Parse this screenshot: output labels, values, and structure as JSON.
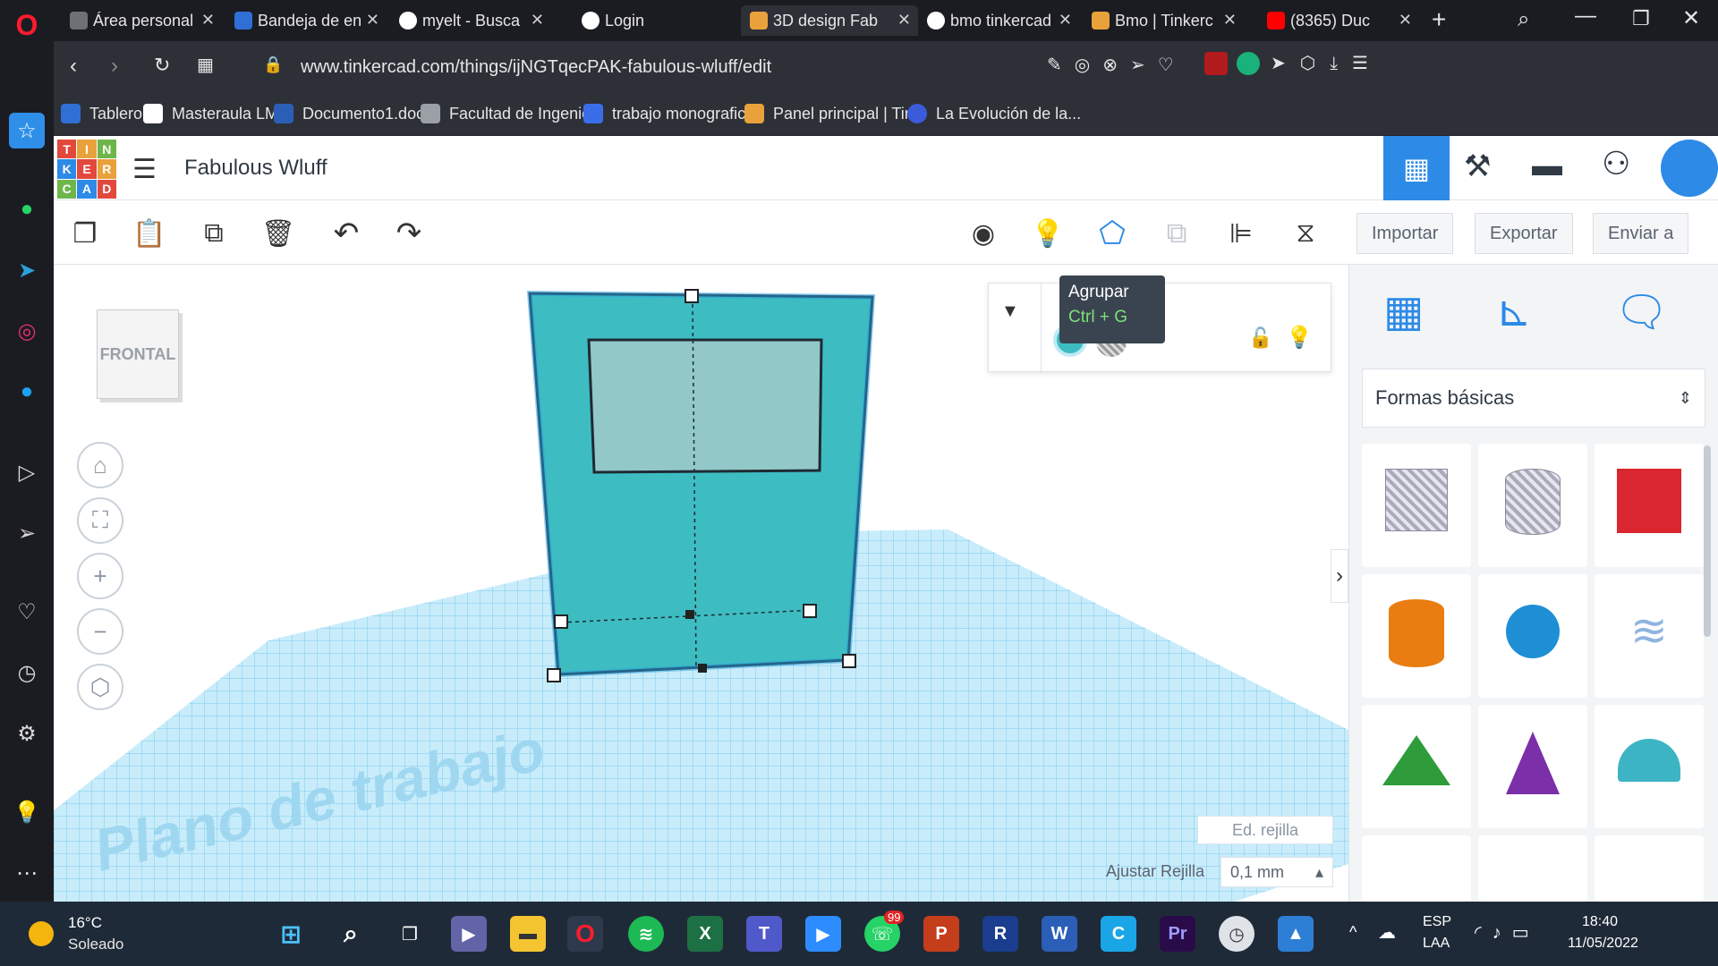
{
  "browser": {
    "tabs": [
      {
        "label": "Área personal",
        "icon": "moodle-icon",
        "color": "#6d7177"
      },
      {
        "label": "Bandeja de en",
        "icon": "mail-icon",
        "color": "#2f6fd6"
      },
      {
        "label": "myelt - Busca",
        "icon": "google-icon",
        "color": "#ffffff"
      },
      {
        "label": "Login",
        "icon": "globe-icon",
        "color": "#ffffff"
      },
      {
        "label": "3D design Fab",
        "icon": "tinkercad-icon",
        "color": "#e9a23b"
      },
      {
        "label": "bmo tinkercad",
        "icon": "google-icon",
        "color": "#ffffff"
      },
      {
        "label": "Bmo | Tinkerc",
        "icon": "tinkercad-icon",
        "color": "#e9a23b"
      },
      {
        "label": "(8365) Duc",
        "icon": "youtube-icon",
        "color": "#ff0000"
      }
    ],
    "url": "www.tinkercad.com/things/ijNGTqecPAK-fabulous-wluff/edit",
    "bookmarks": [
      {
        "label": "Tablero",
        "color": "#2f6fd6"
      },
      {
        "label": "Masteraula LMS",
        "color": "#ffffff"
      },
      {
        "label": "Documento1.docx",
        "color": "#2b5fb7"
      },
      {
        "label": "Facultad de Ingenie...",
        "color": "#9aa0a6"
      },
      {
        "label": "trabajo monografic...",
        "color": "#3a6ee8"
      },
      {
        "label": "Panel principal | Tin...",
        "color": "#e9a23b"
      },
      {
        "label": "La Evolución de la...",
        "color": "#3b5bdb"
      }
    ]
  },
  "tinkercad": {
    "logo_letters": [
      "T",
      "I",
      "N",
      "K",
      "E",
      "R",
      "C",
      "A",
      "D"
    ],
    "design_title": "Fabulous Wluff",
    "toolbar": {
      "import_label": "Importar",
      "export_label": "Exportar",
      "send_label": "Enviar a"
    },
    "tooltip": {
      "title": "Agrupar",
      "shortcut": "Ctrl + G"
    },
    "view_cube_label": "FRONTAL",
    "workplane_text": "Plano de trabajo",
    "shape_category": "Formas básicas",
    "grid_edit_label": "Ed. rejilla",
    "snap_grid_label": "Ajustar Rejilla",
    "snap_grid_value": "0,1 mm",
    "colors": {
      "accent": "#2d8ae6",
      "shape_teal": "#3dbdc2",
      "grid": "#6fc7ec"
    }
  },
  "taskbar": {
    "weather_temp": "16°C",
    "weather_desc": "Soleado",
    "language": "ESP",
    "layout": "LAA",
    "time": "18:40",
    "date": "11/05/2022",
    "whatsapp_badge": "99"
  }
}
